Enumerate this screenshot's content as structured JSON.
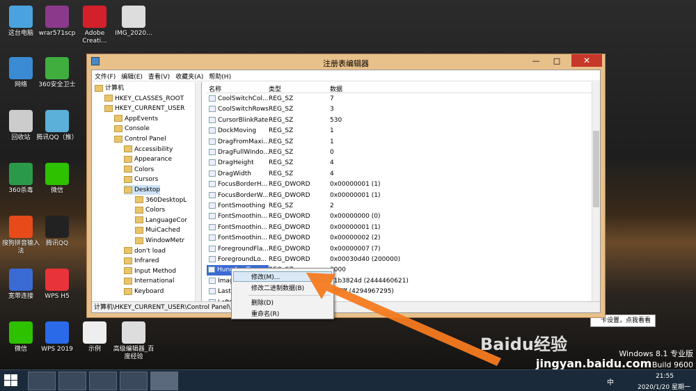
{
  "desktop": {
    "icons": [
      {
        "label": "这台电脑",
        "color": "#4aa3df"
      },
      {
        "label": "wrar571scp",
        "color": "#8b3a8b"
      },
      {
        "label": "Adobe Creati...",
        "color": "#d4202a"
      },
      {
        "label": "IMG_2020...",
        "color": "#ddd"
      },
      {
        "label": "网络",
        "color": "#3a8ad4"
      },
      {
        "label": "360安全卫士",
        "color": "#3fae3f"
      },
      {
        "label": "回收站",
        "color": "#ccc"
      },
      {
        "label": "腾讯QQ（推）",
        "color": "#5ab0d8"
      },
      {
        "label": "360杀毒",
        "color": "#2a9a4a"
      },
      {
        "label": "微信",
        "color": "#2dc100"
      },
      {
        "label": "搜狗拼音输入法",
        "color": "#e84a1a"
      },
      {
        "label": "腾讯QQ",
        "color": "#222"
      },
      {
        "label": "宽带连接",
        "color": "#3a6ad4"
      },
      {
        "label": "WPS H5",
        "color": "#e8333a"
      },
      {
        "label": "微信",
        "color": "#2dc100"
      },
      {
        "label": "WPS 2019",
        "color": "#2a6ae8"
      },
      {
        "label": "示例",
        "color": "#eee"
      },
      {
        "label": "高级编辑器_百度经验",
        "color": "#ddd"
      }
    ]
  },
  "window": {
    "title": "注册表编辑器",
    "close": "✕",
    "minimize": "—",
    "maximize": "□",
    "menu": [
      "文件(F)",
      "编辑(E)",
      "查看(V)",
      "收藏夹(A)",
      "帮助(H)"
    ],
    "tree": [
      "计算机",
      "HKEY_CLASSES_ROOT",
      "HKEY_CURRENT_USER",
      "AppEvents",
      "Console",
      "Control Panel",
      "Accessibility",
      "Appearance",
      "Colors",
      "Cursors",
      "Desktop",
      "360DesktopL",
      "Colors",
      "LanguageCor",
      "MuiCached",
      "WindowMetr",
      "don't load",
      "Infrared",
      "Input Method",
      "International",
      "Keyboard"
    ],
    "columns": {
      "name": "名称",
      "type": "类型",
      "data": "数据"
    },
    "rows": [
      {
        "name": "CoolSwitchCol...",
        "type": "REG_SZ",
        "data": "7"
      },
      {
        "name": "CoolSwitchRows",
        "type": "REG_SZ",
        "data": "3"
      },
      {
        "name": "CursorBlinkRate",
        "type": "REG_SZ",
        "data": "530"
      },
      {
        "name": "DockMoving",
        "type": "REG_SZ",
        "data": "1"
      },
      {
        "name": "DragFromMaxi...",
        "type": "REG_SZ",
        "data": "1"
      },
      {
        "name": "DragFullWindo...",
        "type": "REG_SZ",
        "data": "0"
      },
      {
        "name": "DragHeight",
        "type": "REG_SZ",
        "data": "4"
      },
      {
        "name": "DragWidth",
        "type": "REG_SZ",
        "data": "4"
      },
      {
        "name": "FocusBorderH...",
        "type": "REG_DWORD",
        "data": "0x00000001 (1)"
      },
      {
        "name": "FocusBorderW...",
        "type": "REG_DWORD",
        "data": "0x00000001 (1)"
      },
      {
        "name": "FontSmoothing",
        "type": "REG_SZ",
        "data": "2"
      },
      {
        "name": "FontSmoothin...",
        "type": "REG_DWORD",
        "data": "0x00000000 (0)"
      },
      {
        "name": "FontSmoothin...",
        "type": "REG_DWORD",
        "data": "0x00000001 (1)"
      },
      {
        "name": "FontSmoothin...",
        "type": "REG_DWORD",
        "data": "0x00000002 (2)"
      },
      {
        "name": "ForegroundFla...",
        "type": "REG_DWORD",
        "data": "0x00000007 (7)"
      },
      {
        "name": "ForegroundLo...",
        "type": "REG_DWORD",
        "data": "0x00030d40 (200000)"
      },
      {
        "name": "HungAppTime...",
        "type": "REG_SZ",
        "data": "3000"
      },
      {
        "name": "Image",
        "type": "",
        "data": "91b3824d (2444460621)"
      },
      {
        "name": "LastUp",
        "type": "",
        "data": "ffffffff (4294967295)"
      },
      {
        "name": "LeftOv",
        "type": "",
        "data": ""
      }
    ],
    "status": "计算机\\HKEY_CURRENT_USER\\Control Panel\\Des"
  },
  "context_menu": [
    "修改(M)...",
    "修改二进制数据(B)",
    "删除(D)",
    "重命名(R)"
  ],
  "tooltip": "卡设置，点我看看",
  "watermark": {
    "site": "jingyan.baidu.com",
    "brand": "Baidu经验"
  },
  "os": {
    "edition": "Windows 8.1 专业版",
    "build": "Build 9600"
  },
  "taskbar": {
    "ime": "中",
    "time": "21:55",
    "date": "2020/1/20 星期一"
  },
  "colors": {
    "arrow": "#f47a20",
    "titlebar": "#e8c08a",
    "selection": "#3a6ad4"
  }
}
